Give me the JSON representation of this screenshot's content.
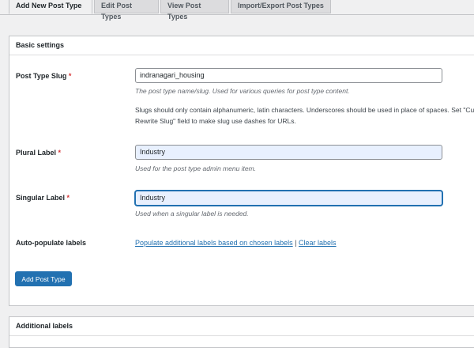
{
  "tabs": [
    {
      "label": "Add New Post Type"
    },
    {
      "label": "Edit Post Types"
    },
    {
      "label": "View Post Types"
    },
    {
      "label": "Import/Export Post Types"
    }
  ],
  "basic_settings": {
    "title": "Basic settings",
    "slug": {
      "label": "Post Type Slug",
      "required": "*",
      "value": "indranagari_housing",
      "description": "The post type name/slug. Used for various queries for post type content.",
      "note_line1": "Slugs should only contain alphanumeric, latin characters. Underscores should be used in place of spaces. Set \"Custom",
      "note_line2": "Rewrite Slug\" field to make slug use dashes for URLs."
    },
    "plural": {
      "label": "Plural Label",
      "required": "*",
      "value": "Industry",
      "description": "Used for the post type admin menu item."
    },
    "singular": {
      "label": "Singular Label",
      "required": "*",
      "value": "Industry",
      "description": "Used when a singular label is needed."
    },
    "auto_populate": {
      "label": "Auto-populate labels",
      "populate_link": "Populate additional labels based on chosen labels",
      "separator": "|",
      "clear_link": "Clear labels"
    },
    "submit_label": "Add Post Type"
  },
  "additional_labels": {
    "title": "Additional labels"
  }
}
